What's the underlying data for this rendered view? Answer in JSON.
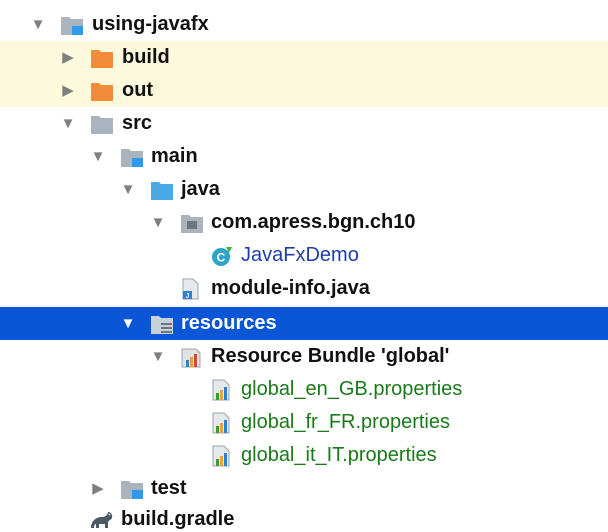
{
  "tree": {
    "items": [
      {
        "label": "using-javafx",
        "toggle": "expanded",
        "icon": "module-folder-icon",
        "state": "normal"
      },
      {
        "label": "build",
        "toggle": "collapsed",
        "icon": "excluded-folder-icon",
        "state": "excluded"
      },
      {
        "label": "out",
        "toggle": "collapsed",
        "icon": "excluded-folder-icon",
        "state": "excluded"
      },
      {
        "label": "src",
        "toggle": "expanded",
        "icon": "folder-icon",
        "state": "normal"
      },
      {
        "label": "main",
        "toggle": "expanded",
        "icon": "module-folder-icon",
        "state": "normal"
      },
      {
        "label": "java",
        "toggle": "expanded",
        "icon": "source-folder-icon",
        "state": "normal"
      },
      {
        "label": "com.apress.bgn.ch10",
        "toggle": "expanded",
        "icon": "package-icon",
        "state": "normal"
      },
      {
        "label": "JavaFxDemo",
        "toggle": "none",
        "icon": "java-class-icon",
        "state": "normal"
      },
      {
        "label": "module-info.java",
        "toggle": "none",
        "icon": "java-file-icon",
        "state": "normal"
      },
      {
        "label": "resources",
        "toggle": "expanded",
        "icon": "resources-folder-icon",
        "state": "selected"
      },
      {
        "label": "Resource Bundle 'global'",
        "toggle": "expanded",
        "icon": "resource-bundle-icon",
        "state": "normal"
      },
      {
        "label": "global_en_GB.properties",
        "toggle": "none",
        "icon": "properties-file-icon",
        "state": "normal"
      },
      {
        "label": "global_fr_FR.properties",
        "toggle": "none",
        "icon": "properties-file-icon",
        "state": "normal"
      },
      {
        "label": "global_it_IT.properties",
        "toggle": "none",
        "icon": "properties-file-icon",
        "state": "normal"
      },
      {
        "label": "test",
        "toggle": "collapsed",
        "icon": "module-folder-icon",
        "state": "normal"
      },
      {
        "label": "build.gradle",
        "toggle": "none",
        "icon": "gradle-icon",
        "state": "normal"
      }
    ]
  },
  "colors": {
    "selection": "#0b56d6",
    "excluded_highlight": "#fcf9dd",
    "excluded_folder": "#f28c38",
    "folder": "#a9b4bf",
    "source_folder": "#4aa9e4",
    "class_text": "#1f3da8",
    "properties_text": "#1a7a1a"
  }
}
